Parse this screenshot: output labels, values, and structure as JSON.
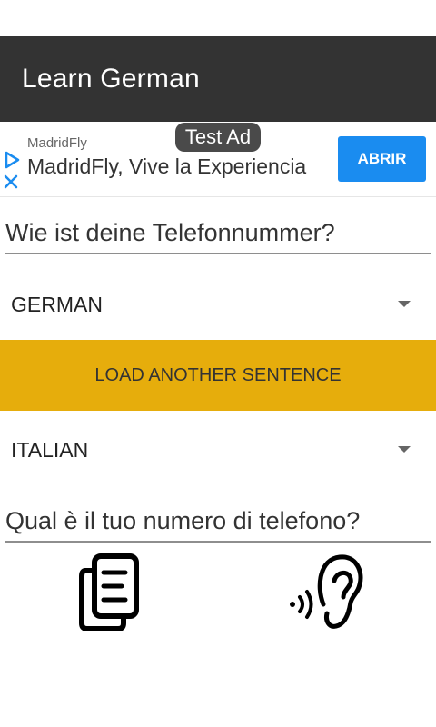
{
  "app": {
    "title": "Learn German"
  },
  "ad": {
    "badge": "Test Ad",
    "advertiser": "MadridFly",
    "headline": "MadridFly, Vive la Experiencia",
    "cta": "ABRIR",
    "icons": [
      "adchoices-play-icon",
      "close-icon"
    ],
    "colors": {
      "cta": "#1a8cf0",
      "choices": "#1a8cf0"
    }
  },
  "source": {
    "sentence": "Wie ist deine Telefonnummer?",
    "language": "GERMAN"
  },
  "actions": {
    "load_label": "LOAD ANOTHER SENTENCE"
  },
  "target": {
    "sentence": "Qual è il tuo numero di telefono?",
    "language": "ITALIAN"
  },
  "icons": {
    "dropdown": "chevron-down-icon",
    "copy": "copy-icon",
    "listen": "ear-sound-icon"
  },
  "colors": {
    "app_bar": "#333333",
    "load_button": "#e6ad0c",
    "underline": "#8e8e8e"
  }
}
